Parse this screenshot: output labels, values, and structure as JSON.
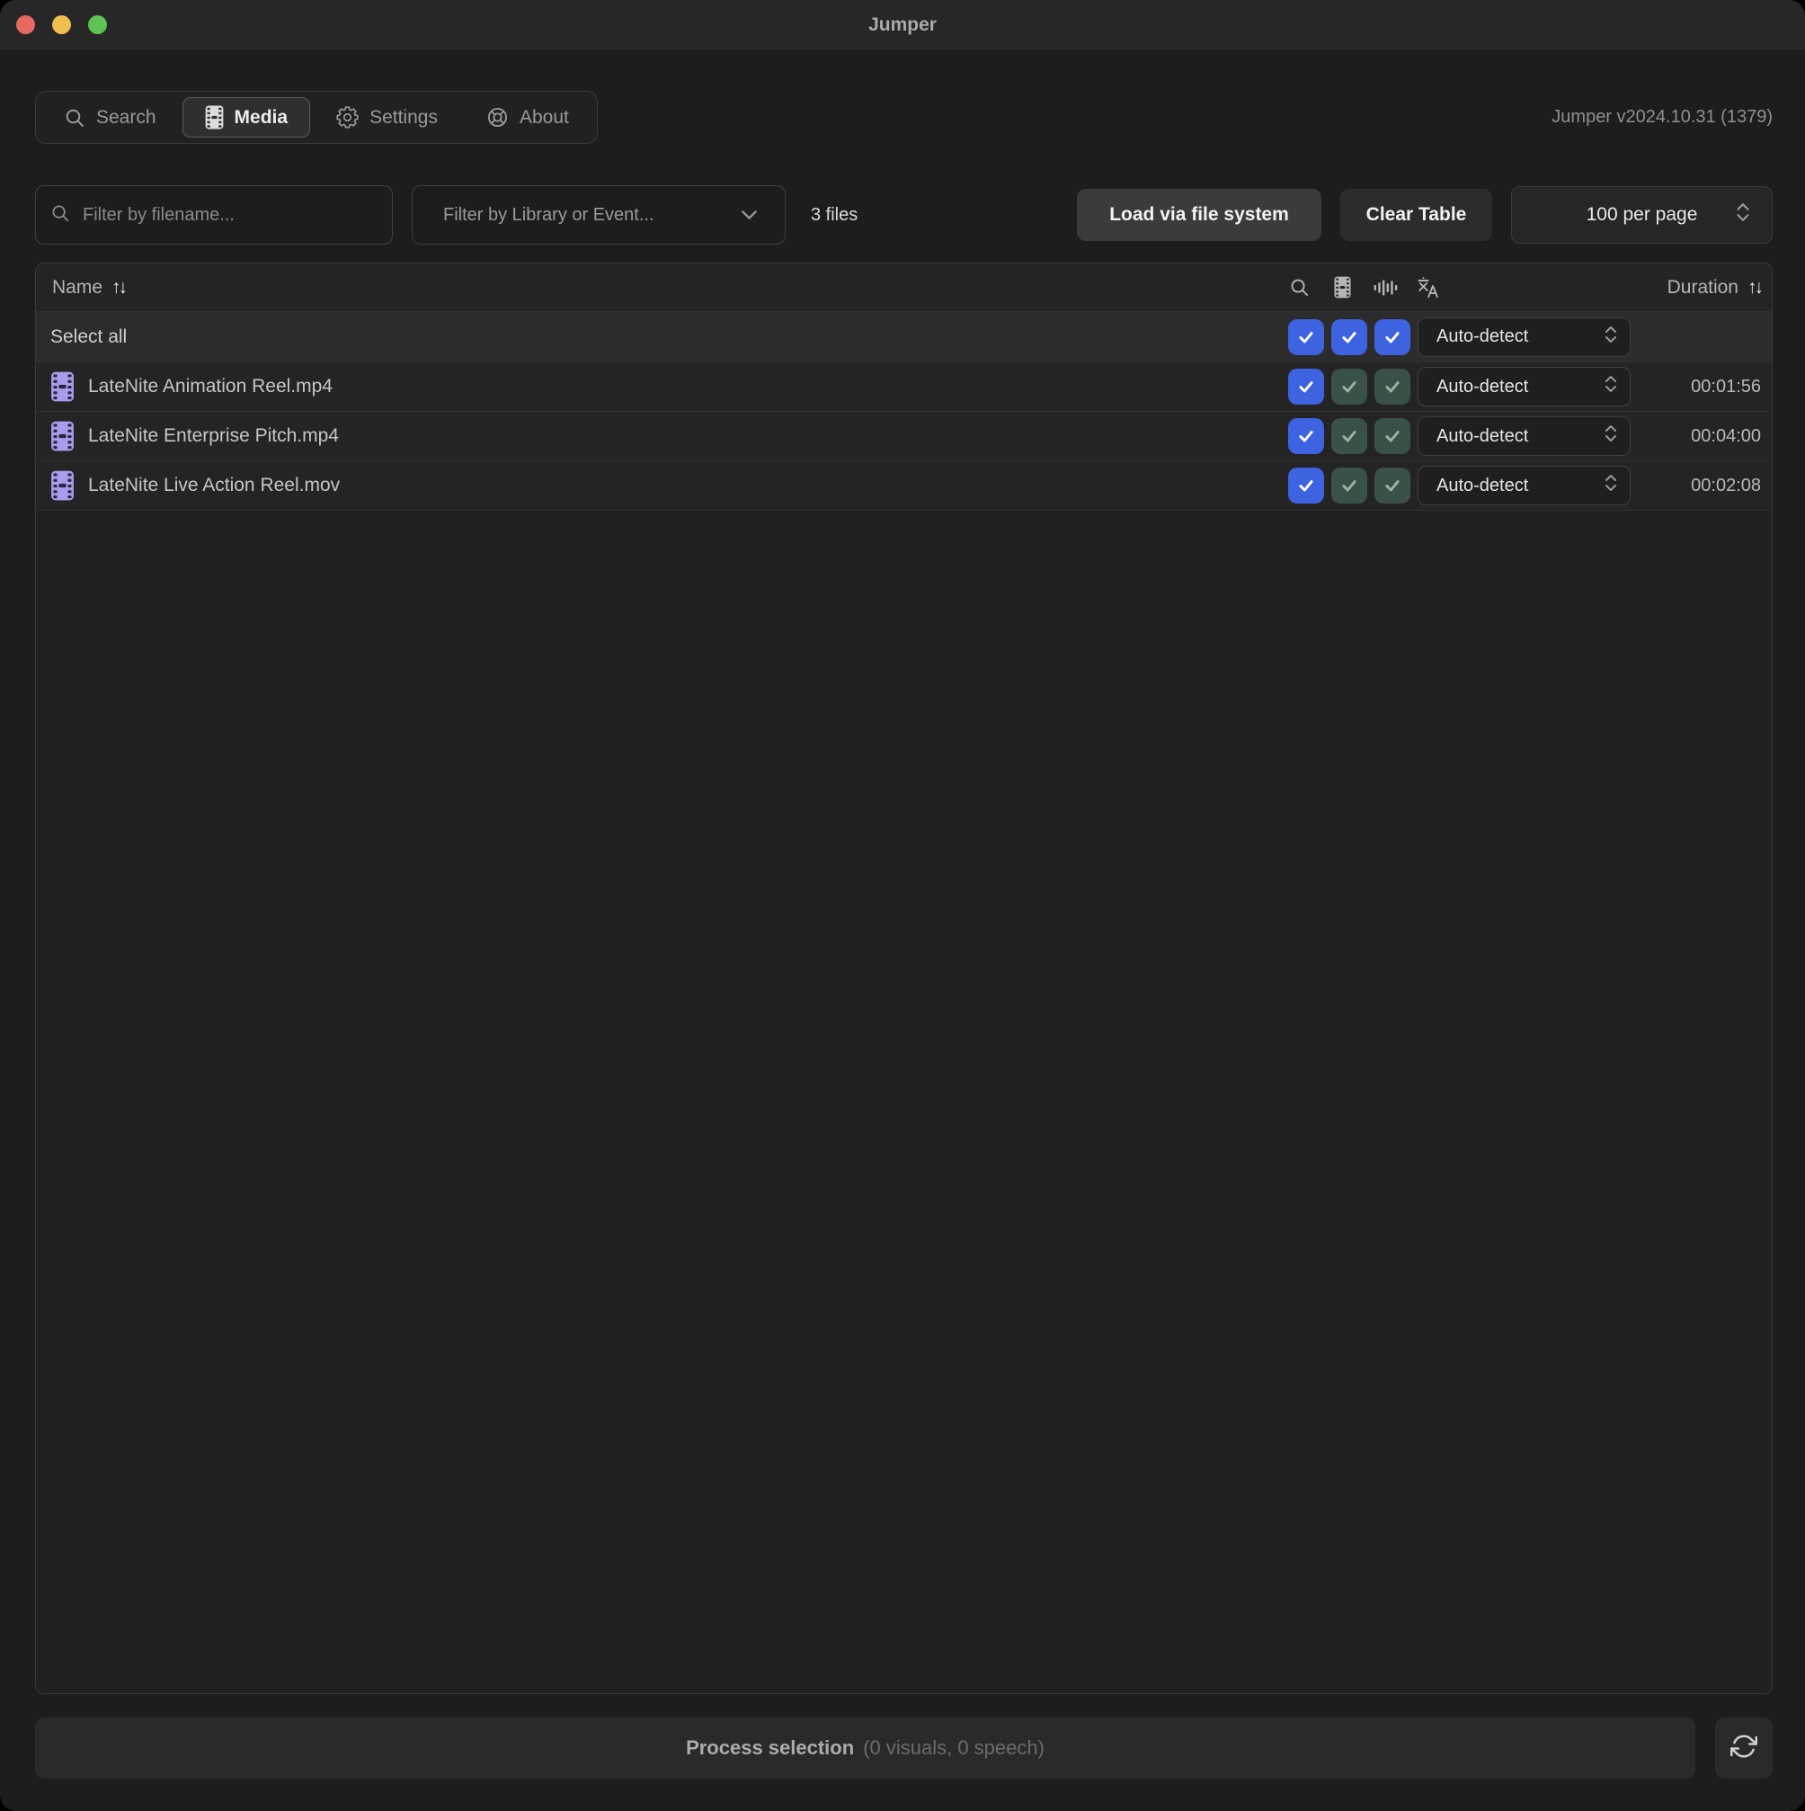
{
  "window": {
    "title": "Jumper",
    "version": "Jumper v2024.10.31 (1379)"
  },
  "tabs": [
    {
      "label": "Search",
      "active": false
    },
    {
      "label": "Media",
      "active": true
    },
    {
      "label": "Settings",
      "active": false
    },
    {
      "label": "About",
      "active": false
    }
  ],
  "toolbar": {
    "filename_filter": {
      "placeholder": "Filter by filename...",
      "value": ""
    },
    "library_filter_label": "Filter by Library or Event...",
    "file_count": "3 files",
    "load_button_label": "Load via file system",
    "clear_button_label": "Clear Table",
    "page_size_label": "100 per page"
  },
  "table": {
    "headers": {
      "name": "Name",
      "duration": "Duration",
      "sort_glyph": "↑↓"
    },
    "select_all": {
      "label": "Select all",
      "checks": [
        "blue",
        "blue",
        "blue"
      ],
      "detect": "Auto-detect"
    },
    "rows": [
      {
        "name": "LateNite Animation Reel.mp4",
        "checks": [
          "blue",
          "green",
          "green"
        ],
        "detect": "Auto-detect",
        "duration": "00:01:56"
      },
      {
        "name": "LateNite Enterprise Pitch.mp4",
        "checks": [
          "blue",
          "green",
          "green"
        ],
        "detect": "Auto-detect",
        "duration": "00:04:00"
      },
      {
        "name": "LateNite Live Action Reel.mov",
        "checks": [
          "blue",
          "green",
          "green"
        ],
        "detect": "Auto-detect",
        "duration": "00:02:08"
      }
    ]
  },
  "footer": {
    "process_label": "Process selection",
    "process_detail": "(0 visuals, 0 speech)"
  },
  "colors": {
    "accent_blue": "#3D63E1",
    "check_green_bg": "#3A5148",
    "check_green_mark": "#9FB3A4",
    "file_icon_purple": "#A89CEC",
    "traffic_red": "#E8695F",
    "traffic_yellow": "#EFBE4F",
    "traffic_green": "#5FC254"
  }
}
